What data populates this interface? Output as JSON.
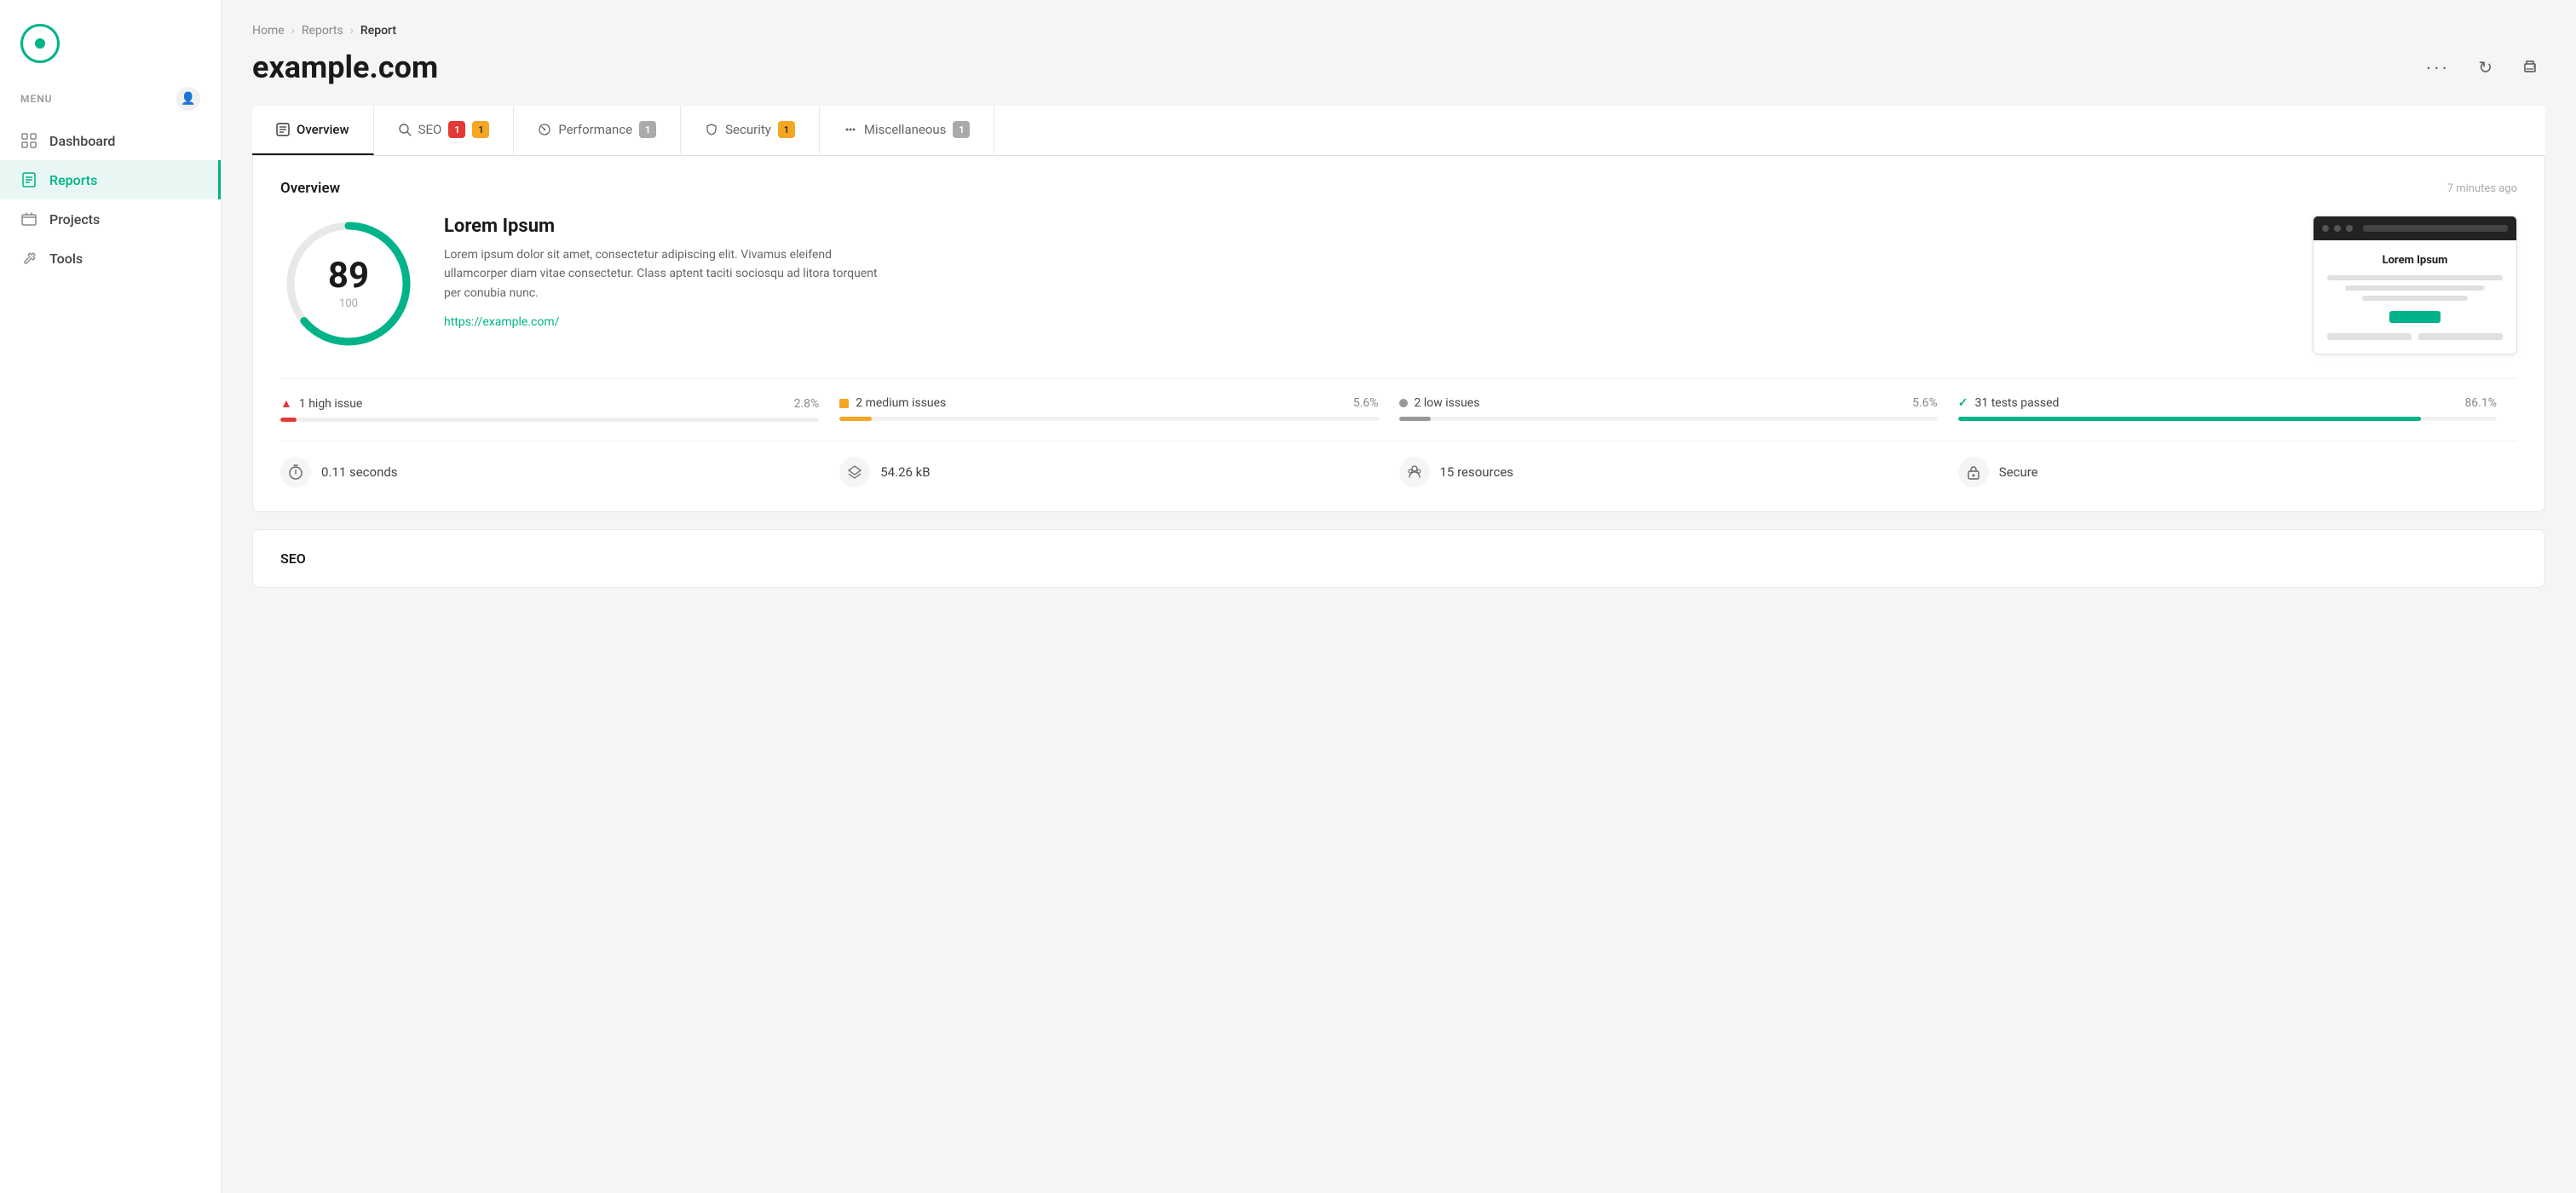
{
  "sidebar": {
    "menu_label": "MENU",
    "nav_items": [
      {
        "id": "dashboard",
        "label": "Dashboard",
        "active": false
      },
      {
        "id": "reports",
        "label": "Reports",
        "active": true
      },
      {
        "id": "projects",
        "label": "Projects",
        "active": false
      },
      {
        "id": "tools",
        "label": "Tools",
        "active": false
      }
    ]
  },
  "breadcrumb": {
    "items": [
      "Home",
      "Reports",
      "Report"
    ]
  },
  "page": {
    "title": "example.com"
  },
  "tabs": [
    {
      "id": "overview",
      "label": "Overview",
      "badge": null,
      "active": true
    },
    {
      "id": "seo",
      "label": "SEO",
      "badge_red": "1",
      "badge_yellow": "1",
      "active": false
    },
    {
      "id": "performance",
      "label": "Performance",
      "badge_gray": "1",
      "active": false
    },
    {
      "id": "security",
      "label": "Security",
      "badge_yellow": "1",
      "active": false
    },
    {
      "id": "miscellaneous",
      "label": "Miscellaneous",
      "badge_gray": "1",
      "active": false
    }
  ],
  "overview": {
    "title": "Overview",
    "timestamp": "7 minutes ago",
    "score": {
      "value": "89",
      "total": "100",
      "percent": 89
    },
    "info": {
      "title": "Lorem Ipsum",
      "description": "Lorem ipsum dolor sit amet, consectetur adipiscing elit. Vivamus eleifend ullamcorper diam vitae consectetur. Class aptent taciti sociosqu ad litora torquent per conubia nunc.",
      "url": "https://example.com/"
    },
    "preview": {
      "title": "Lorem Ipsum",
      "button_label": ""
    },
    "issues": [
      {
        "id": "high",
        "icon": "triangle",
        "label": "1 high issue",
        "pct": "2.8%",
        "fill_pct": 3,
        "color": "red"
      },
      {
        "id": "medium",
        "icon": "square",
        "label": "2 medium issues",
        "pct": "5.6%",
        "fill_pct": 6,
        "color": "yellow"
      },
      {
        "id": "low",
        "icon": "circle",
        "label": "2 low issues",
        "pct": "5.6%",
        "fill_pct": 6,
        "color": "gray"
      },
      {
        "id": "passed",
        "icon": "check",
        "label": "31 tests passed",
        "pct": "86.1%",
        "fill_pct": 86,
        "color": "green"
      }
    ],
    "stats": [
      {
        "id": "time",
        "icon": "⏱",
        "label": "0.11 seconds"
      },
      {
        "id": "size",
        "icon": "⚖",
        "label": "54.26 kB"
      },
      {
        "id": "resources",
        "icon": "👥",
        "label": "15 resources"
      },
      {
        "id": "security",
        "icon": "🔒",
        "label": "Secure"
      }
    ]
  },
  "seo_section": {
    "title": "SEO"
  },
  "actions": {
    "more": "···",
    "refresh": "↻",
    "print": "🖨"
  }
}
